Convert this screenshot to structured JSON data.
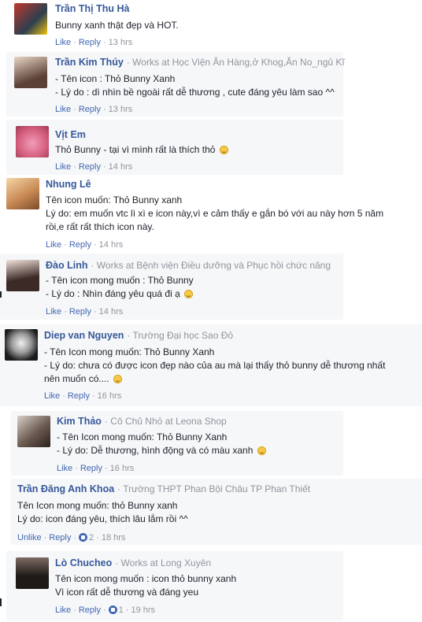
{
  "comments": [
    {
      "name": "Trần Thị Thu Hà",
      "meta": "",
      "lines": [
        "Bunny xanh thật đẹp và HOT."
      ],
      "like": "Like",
      "reply": "Reply",
      "time": "13 hrs",
      "reactions": ""
    },
    {
      "name": "Trần Kim Thúy",
      "meta": "· Works at Học Viện Ăn Hàng,ở Khog,Ăn No_ngủ Kĩ",
      "lines": [
        "- Tên icon : Thỏ Bunny Xanh",
        "- Lý do : dì nhìn bề ngoài rất dễ thương , cute đáng yêu làm sao ^^"
      ],
      "like": "Like",
      "reply": "Reply",
      "time": "13 hrs",
      "reactions": ""
    },
    {
      "name": "Vịt Em",
      "meta": "",
      "lines": [
        "Thỏ Bunny - tại vì mình rất là thích thỏ"
      ],
      "like": "Like",
      "reply": "Reply",
      "time": "14 hrs",
      "reactions": ""
    },
    {
      "name": "Nhung Lê",
      "meta": "",
      "lines": [
        "Tên icon muốn: Thỏ Bunny xanh",
        "Lý do: em muốn vtc lì xì e icon này,vì e cảm thấy e gắn bó với au này hơn 5 năm",
        "rồi,e rất rất thích icon này."
      ],
      "like": "Like",
      "reply": "Reply",
      "time": "14 hrs",
      "reactions": ""
    },
    {
      "name": "Đào Linh",
      "meta": "· Works at Bệnh viện Điều dưỡng và Phục hồi chức năng",
      "lines": [
        "- Tên icon mong muốn : Thỏ Bunny",
        "- Lý do : Nhìn đáng yêu quá đi ạ"
      ],
      "like": "Like",
      "reply": "Reply",
      "time": "14 hrs",
      "reactions": ""
    },
    {
      "name": "Diep van Nguyen",
      "meta": "· Trường Đại học Sao Đỏ",
      "lines": [
        "- Tên Icon mong muốn: Thỏ Bunny Xanh",
        "- Lý do: chưa có được icon đẹp nào của au mà lại thấy thỏ bunny dễ thương nhất",
        "nên muốn có...."
      ],
      "like": "Like",
      "reply": "Reply",
      "time": "16 hrs",
      "reactions": ""
    },
    {
      "name": "Kim Thảo",
      "meta": "· Cô Chủ Nhỏ at Leona Shop",
      "lines": [
        "- Tên Icon mong muốn: Thỏ Bunny Xanh",
        "- Lý do: Dễ thương, hình động và có màu xanh"
      ],
      "like": "Like",
      "reply": "Reply",
      "time": "16 hrs",
      "reactions": ""
    },
    {
      "name": "Trần Đăng Anh Khoa",
      "meta": "· Trường THPT Phan Bội Châu TP Phan Thiết",
      "lines": [
        "Tên Icon mong muốn: thỏ Bunny xanh",
        "Lý do: icon đáng yêu, thích lâu lắm rồi ^^"
      ],
      "like": "Unlike",
      "reply": "Reply",
      "time": "18 hrs",
      "reactions": "2"
    },
    {
      "name": "Lò Chucheo",
      "meta": "· Works at Long Xuyên",
      "lines": [
        "Tên icon mong muốn : icon thỏ bunny xanh",
        "Vì icon rất dễ thương và đáng yeu"
      ],
      "like": "Like",
      "reply": "Reply",
      "time": "19 hrs",
      "reactions": "1"
    }
  ],
  "colors": {
    "name": "#365899",
    "link": "#4267b2",
    "meta": "#90949c",
    "panel": "#f6f7f9"
  },
  "icons": {
    "emoji": "smile-emoji-icon",
    "reaction": "like-reaction-icon"
  }
}
